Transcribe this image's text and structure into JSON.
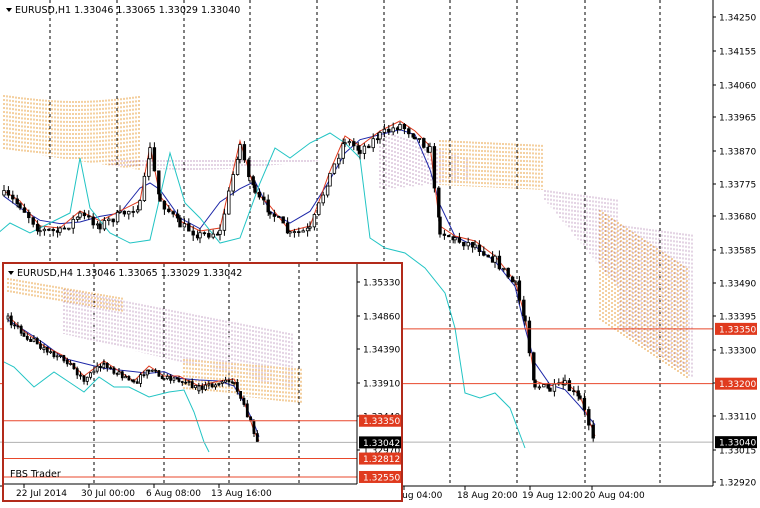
{
  "main": {
    "header": "EURUSD,H1  1.33046 1.33065 1.33029 1.33040",
    "price_ticks": [
      "1.34250",
      "1.34155",
      "1.34060",
      "1.33965",
      "1.33870",
      "1.33775",
      "1.33680",
      "1.33585",
      "1.33490",
      "1.33395",
      "1.33300",
      "1.33205",
      "1.33110",
      "1.33015",
      "1.32920"
    ],
    "time_labels": [
      "Aug 04:00",
      "18 Aug 20:00",
      "19 Aug 12:00",
      "20 Aug 04:00"
    ],
    "levels": [
      {
        "label": "1.33350",
        "price": 1.3335
      },
      {
        "label": "1.33200",
        "price": 1.332
      }
    ],
    "current_price": "1.33040",
    "price_min": 1.3292,
    "price_max": 1.3425
  },
  "inset": {
    "header": "EURUSD,H4  1.33046 1.33065 1.33029 1.33042",
    "price_ticks": [
      "1.35330",
      "1.34860",
      "1.34390",
      "1.33910",
      "1.33440",
      "1.32970"
    ],
    "time_labels": [
      "22 Jul 2014",
      "30 Jul 00:00",
      "6 Aug 08:00",
      "13 Aug 16:00"
    ],
    "levels": [
      {
        "label": "1.33350",
        "price": 1.3335
      },
      {
        "label": "1.32812",
        "price": 1.32812
      },
      {
        "label": "1.32550",
        "price": 1.3255
      }
    ],
    "current_price": "1.33042",
    "watermark": "FBS Trader",
    "price_min": 1.3245,
    "price_max": 1.3558
  },
  "colors": {
    "level_line": "#e8472b",
    "level_label_bg": "#e03a1e",
    "current_bg": "#000000",
    "candle": "#000000",
    "tenkan": "#e03a1e",
    "kijun": "#1d27a8",
    "chikou": "#22c4c4",
    "cloud_orange": "#e8a040",
    "cloud_violet": "#c8a8c8",
    "grid": "#000000",
    "inset_border": "#b22a1a"
  }
}
